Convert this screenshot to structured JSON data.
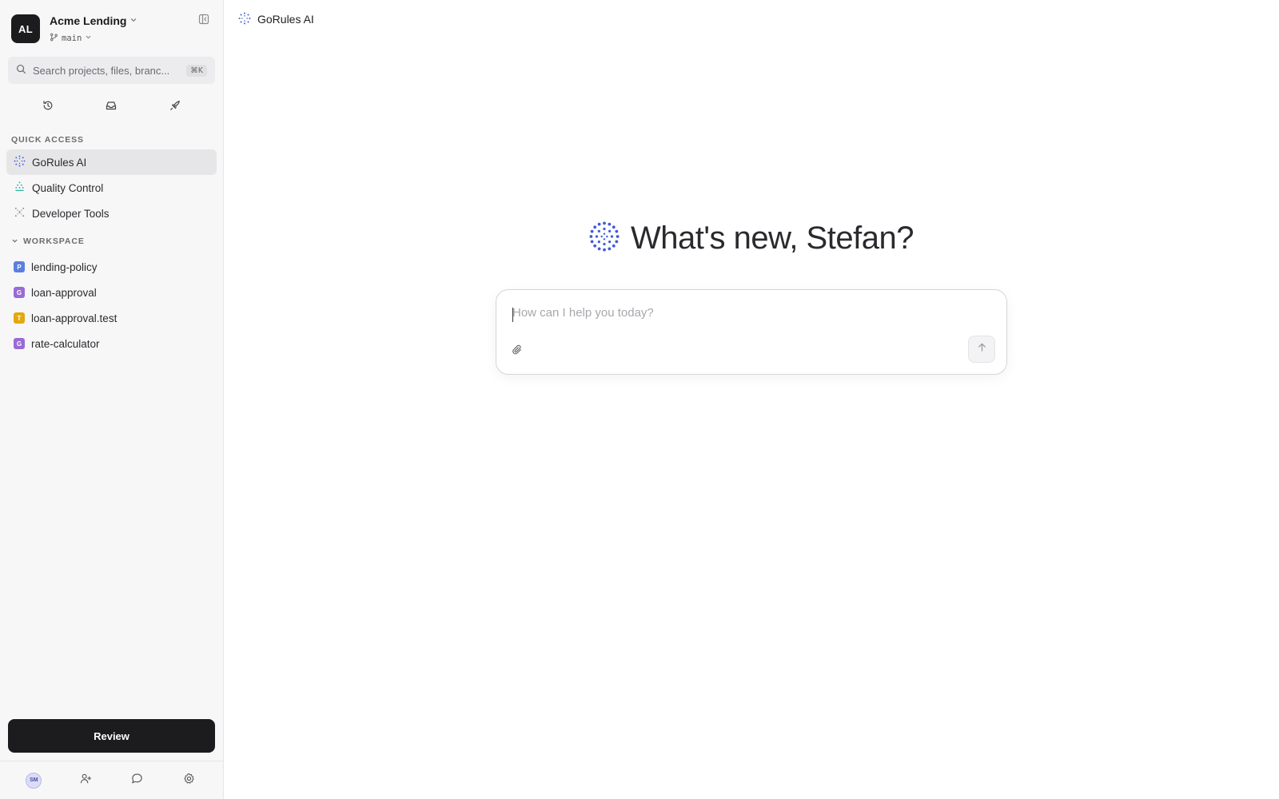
{
  "org": {
    "initials": "AL",
    "name": "Acme Lending",
    "branch": "main"
  },
  "search": {
    "placeholder": "Search projects, files, branc...",
    "shortcut": "⌘K"
  },
  "quick_icons": [
    "history-icon",
    "inbox-icon",
    "rocket-icon"
  ],
  "quick_access": {
    "title": "QUICK ACCESS",
    "items": [
      {
        "label": "GoRules AI",
        "icon": "gorules-ai-icon",
        "active": true
      },
      {
        "label": "Quality Control",
        "icon": "quality-control-icon",
        "active": false
      },
      {
        "label": "Developer Tools",
        "icon": "developer-tools-icon",
        "active": false
      }
    ]
  },
  "workspace": {
    "title": "WORKSPACE",
    "items": [
      {
        "label": "lending-policy",
        "badge": "P",
        "color": "#5b7fe0"
      },
      {
        "label": "loan-approval",
        "badge": "G",
        "color": "#9a6ad6"
      },
      {
        "label": "loan-approval.test",
        "badge": "T",
        "color": "#e3a80e"
      },
      {
        "label": "rate-calculator",
        "badge": "G",
        "color": "#9a6ad6"
      }
    ]
  },
  "review_button": "Review",
  "user": {
    "initials": "SM"
  },
  "breadcrumb": {
    "label": "GoRules AI"
  },
  "hero": {
    "title": "What's new, Stefan?"
  },
  "composer": {
    "placeholder": "How can I help you today?"
  },
  "colors": {
    "accent": "#3f5bd9",
    "dark": "#1c1c1e",
    "teal": "#2bb5a0"
  }
}
